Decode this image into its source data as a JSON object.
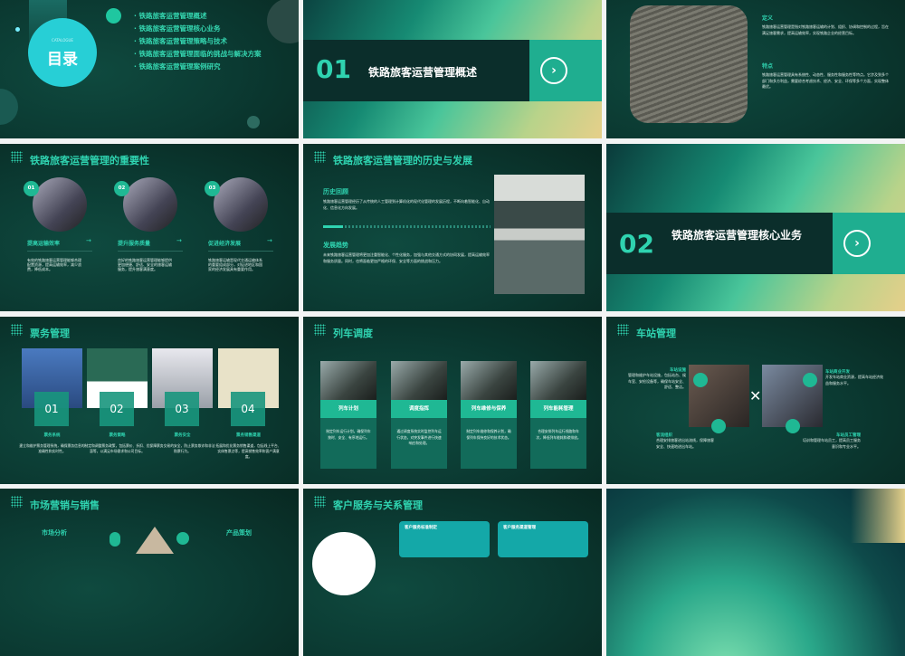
{
  "slides": [
    {
      "catalogue_label": "CATALOGUE",
      "title": "目录",
      "items": [
        "铁路旅客运营管理概述",
        "铁路旅客运营管理核心业务",
        "铁路旅客运营管理策略与技术",
        "铁路旅客运营管理面临的挑战与解决方案",
        "铁路旅客运营管理案例研究"
      ]
    },
    {
      "number": "01",
      "title": "铁路旅客运营管理概述",
      "icon": "chevron-right-icon"
    },
    {
      "sections": [
        {
          "heading": "定义",
          "text": "铁路旅客运营管理是指对铁路旅客运输的计划、组织、协调和控制的过程，旨在满足旅客需求，提高运输效率，实现铁路企业的经营目标。"
        },
        {
          "heading": "特点",
          "text": "铁路旅客运营管理具有系统性、动态性、服务性和服务性等特点。它涉及到多个部门和多方利益，需要综合考虑技术、经济、安全、环保等多个方面，实现整体最优。"
        }
      ]
    },
    {
      "title": "铁路旅客运营管理的重要性",
      "cards": [
        {
          "num": "01",
          "heading": "提高运输效率",
          "text": "有效的铁路旅客运营管理能够合理配置资源，提高运输效率，减少浪费，降低成本。"
        },
        {
          "num": "02",
          "heading": "提升服务质量",
          "text": "良好的铁路旅客运营管理能够提供更加便捷、舒适、安全的旅客运输服务，提升旅客满意度。"
        },
        {
          "num": "03",
          "heading": "促进经济发展",
          "text": "铁路旅客运输是现代交通运输体系的重要组成部分，对促进地区和国家的经济发展具有重要作用。"
        }
      ]
    },
    {
      "title": "铁路旅客运营管理的历史与发展",
      "sections": [
        {
          "heading": "历史回顾",
          "text": "铁路旅客运营管理经历了从传统的人工管理到计算机化的现代化管理的发展历程，不断向着智能化、自动化、信息化方向发展。"
        },
        {
          "heading": "发展趋势",
          "text": "未来铁路旅客运营管理将更加注重智能化、个性化服务，加强与其他交通方式的协同发展，提高运输效率和服务质量。同时，也将面临更加严格的环保、安全等方面的挑战和压力。"
        }
      ]
    },
    {
      "number": "02",
      "title": "铁路旅客运营管理核心业务",
      "icon": "chevron-right-icon"
    },
    {
      "title": "票务管理",
      "cards": [
        {
          "num": "01",
          "heading": "票务系统",
          "text": "建立和维护票务管理系统，确保票务信息的准确性和实时性。"
        },
        {
          "num": "02",
          "heading": "票务策略",
          "text": "制定和调整票务政策，包括票价、折扣、优惠等，以满足市场需求和公司目标。"
        },
        {
          "num": "03",
          "heading": "票务安全",
          "text": "保障票务交易的安全，防止票务欺诈和非法购票行为。"
        },
        {
          "num": "04",
          "heading": "票务销售渠道",
          "text": "拓展和优化票务销售渠道，包括线上平台、实体售票点等，提高销售效率和客户满意度。"
        }
      ]
    },
    {
      "title": "列车调度",
      "cards": [
        {
          "heading": "列车计划",
          "text": "制定列车运行计划，确保列车按时、安全、有序地运行。"
        },
        {
          "heading": "调度指挥",
          "text": "通过调度系统实时监控列车运行状态，对突发事件进行快速响应和处理。"
        },
        {
          "heading": "列车维修与保养",
          "text": "制定列车维修和保养计划，确保列车保持良好的技术状态。"
        },
        {
          "heading": "列车能耗管理",
          "text": "合理安排列车运行线路和车次，降低列车能耗和碳排放。"
        }
      ]
    },
    {
      "title": "车站管理",
      "items": [
        {
          "heading": "车站设施",
          "text": "管理和维护车站设施，包括站台、候车室、安检设备等，确保车站安全、舒适、整洁。"
        },
        {
          "heading": "车站商业开发",
          "text": "开发车站商业资源，提高车站经济效益和服务水平。"
        },
        {
          "heading": "客流组织",
          "text": "合理安排旅客进出站流线，保障旅客安全、快速地进出车站。"
        },
        {
          "heading": "车站员工管理",
          "text": "培训和管理车站员工，提高员工服务意识和专业水平。"
        }
      ]
    },
    {
      "title": "市场营销与销售",
      "labels": [
        "市场分析",
        "产品策划"
      ]
    },
    {
      "title": "客户服务与关系管理",
      "boxes": [
        "客户服务标准制定",
        "客户服务渠道管理"
      ]
    },
    {}
  ],
  "colors": {
    "accent": "#2fd3b0",
    "dark": "#0b3a32"
  }
}
